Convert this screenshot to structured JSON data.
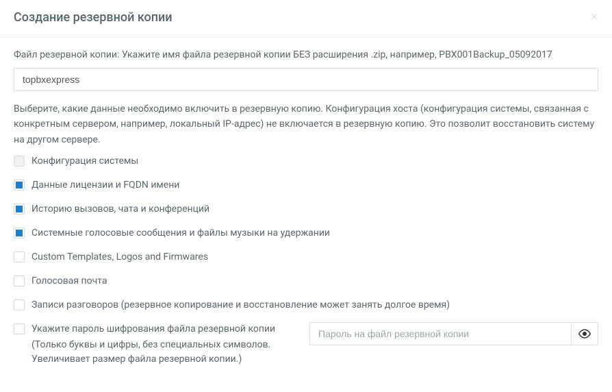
{
  "modal": {
    "title": "Создание резервной копии"
  },
  "filename": {
    "label": "Файл резервной копии: Укажите имя файла резервной копии БЕЗ расширения .zip, например, PBX001Backup_05092017",
    "value": "topbxexpress"
  },
  "description": "Выберите, какие данные необходимо включить в резервную копию. Конфигурация хоста (конфигурация системы, связанная с конкретным сервером, например, локальный IP-адрес) не включается в резервную копию. Это позволит восстановить систему на другом сервере.",
  "options": {
    "systemConfig": "Конфигурация системы",
    "licenseFqdn": "Данные лицензии и FQDN имени",
    "callHistory": "Историю вызовов, чата и конференций",
    "systemVoice": "Системные голосовые сообщения и файлы музыки на удержании",
    "customTemplates": "Custom Templates, Logos and Firmwares",
    "voicemail": "Голосовая почта",
    "recordings": "Записи разговоров (резервное копирование и восстановление может занять долгое время)"
  },
  "password": {
    "label": "Укажите пароль шифрования файла резервной копии",
    "sublabel": "(Только буквы и цифры, без специальных символов. Увеличивает размер файла резервной копии.)",
    "placeholder": "Пароль на файл резервной копии"
  }
}
